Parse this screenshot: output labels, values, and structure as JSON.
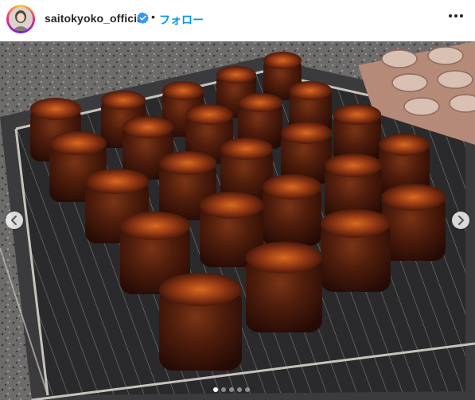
{
  "post_header": {
    "username": "saitokyoko_official",
    "separator": "•",
    "follow_label": "フォロー",
    "verified": true
  },
  "post_media": {
    "description_icon": "photo-of-canele-pastries",
    "carousel": {
      "slide_count": 5,
      "active_index": 0
    }
  },
  "icons": {
    "verified": "verified-badge-icon",
    "more": "more-options-icon",
    "prev": "chevron-left-icon",
    "next": "chevron-right-icon"
  },
  "colors": {
    "follow_blue": "#0095f6",
    "verified_blue": "#3897f0",
    "text": "#262626"
  }
}
